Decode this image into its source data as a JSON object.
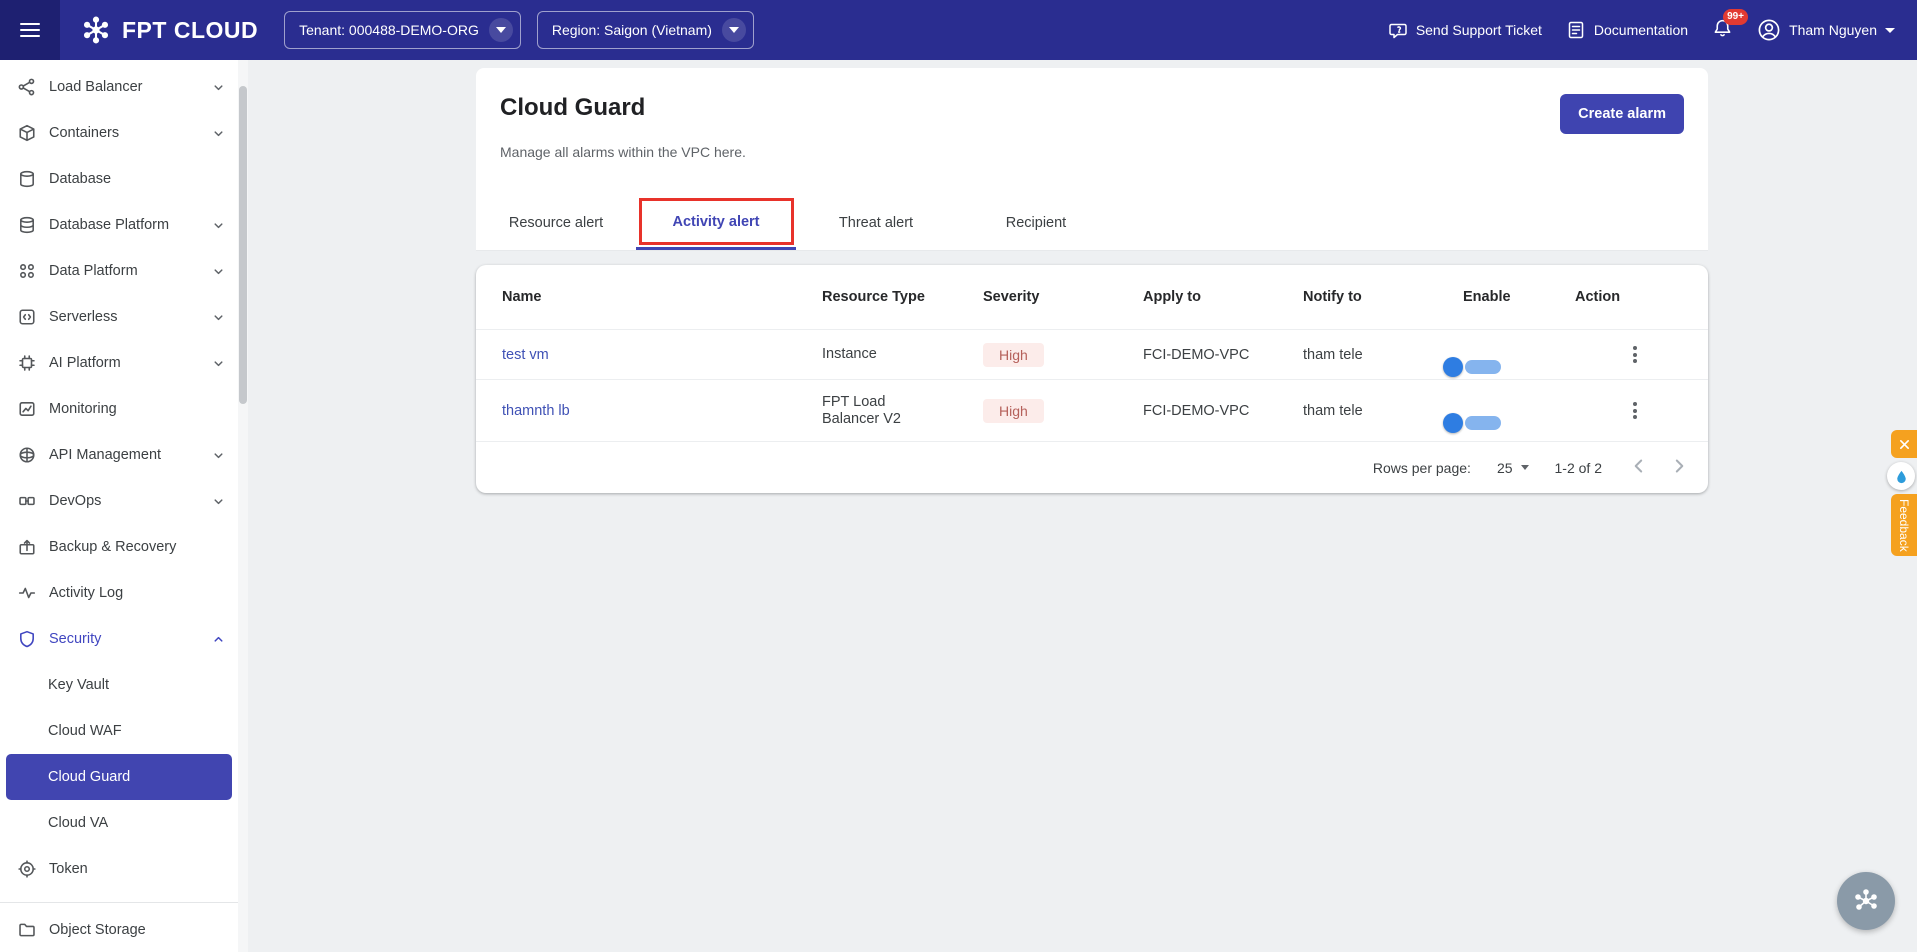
{
  "header": {
    "logo": "FPT CLOUD",
    "tenant": "Tenant: 000488-DEMO-ORG",
    "region": "Region: Saigon (Vietnam)",
    "support": "Send Support Ticket",
    "documentation": "Documentation",
    "notification_badge": "99+",
    "user": "Tham Nguyen"
  },
  "sidebar": {
    "items": [
      {
        "label": "Load Balancer"
      },
      {
        "label": "Containers"
      },
      {
        "label": "Database"
      },
      {
        "label": "Database Platform"
      },
      {
        "label": "Data Platform"
      },
      {
        "label": "Serverless"
      },
      {
        "label": "AI Platform"
      },
      {
        "label": "Monitoring"
      },
      {
        "label": "API Management"
      },
      {
        "label": "DevOps"
      },
      {
        "label": "Backup & Recovery"
      },
      {
        "label": "Activity Log"
      },
      {
        "label": "Security"
      },
      {
        "label": "Key Vault"
      },
      {
        "label": "Cloud WAF"
      },
      {
        "label": "Cloud Guard"
      },
      {
        "label": "Cloud VA"
      },
      {
        "label": "Token"
      },
      {
        "label": "Object Storage"
      }
    ]
  },
  "page": {
    "title": "Cloud Guard",
    "subtitle": "Manage all alarms within the VPC here.",
    "create_button": "Create alarm",
    "tabs": [
      {
        "label": "Resource alert"
      },
      {
        "label": "Activity alert"
      },
      {
        "label": "Threat alert"
      },
      {
        "label": "Recipient"
      }
    ],
    "active_tab": "Activity alert"
  },
  "table": {
    "headers": {
      "name": "Name",
      "resource_type": "Resource Type",
      "severity": "Severity",
      "apply_to": "Apply to",
      "notify_to": "Notify to",
      "enable": "Enable",
      "action": "Action"
    },
    "rows": [
      {
        "name": "test vm",
        "resource_type": "Instance",
        "severity": "High",
        "apply_to": "FCI-DEMO-VPC",
        "notify_to": "tham tele",
        "enabled": true
      },
      {
        "name": "thamnth lb",
        "resource_type": "FPT Load Balancer V2",
        "severity": "High",
        "apply_to": "FCI-DEMO-VPC",
        "notify_to": "tham tele",
        "enabled": true
      }
    ],
    "pagination": {
      "rows_per_page_label": "Rows per page:",
      "rows_per_page_value": "25",
      "range": "1-2 of 2"
    }
  },
  "feedback": {
    "label": "Feedback"
  },
  "colors": {
    "accent": "#3f44b0",
    "header": "#2a2d90",
    "severity_high_bg": "#fcecea",
    "severity_high_text": "#b5605a",
    "annotation_red": "#e8322a"
  }
}
